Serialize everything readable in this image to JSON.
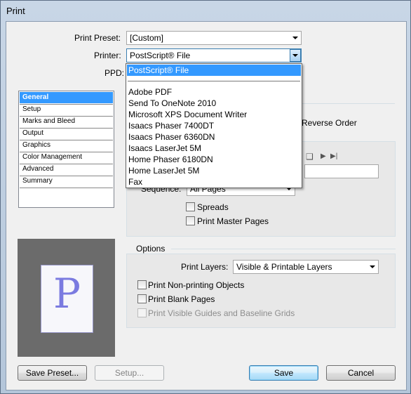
{
  "window": {
    "title": "Print"
  },
  "print_preset": {
    "label": "Print Preset:",
    "value": "[Custom]"
  },
  "printer": {
    "label": "Printer:",
    "value": "PostScript® File"
  },
  "ppd": {
    "label": "PPD:"
  },
  "sidebar": {
    "items": [
      {
        "label": "General",
        "selected": true
      },
      {
        "label": "Setup"
      },
      {
        "label": "Marks and Bleed"
      },
      {
        "label": "Output"
      },
      {
        "label": "Graphics"
      },
      {
        "label": "Color Management"
      },
      {
        "label": "Advanced"
      },
      {
        "label": "Summary"
      }
    ]
  },
  "printer_dropdown": {
    "items": [
      "PostScript® File",
      "Adobe PDF",
      "Send To OneNote 2010",
      "Microsoft XPS Document Writer",
      "Isaacs Phaser 7400DT",
      "Isaacs Phaser 6360DN",
      "Isaacs LaserJet 5M",
      "Home Phaser 6180DN",
      "Home LaserJet 5M",
      "Fax"
    ],
    "highlighted": "PostScript® File"
  },
  "pages": {
    "reverse_order_label": "Reverse Order",
    "sequence_label": "Sequence:",
    "sequence_value": "All Pages",
    "spreads_label": "Spreads",
    "print_master_pages_label": "Print Master Pages"
  },
  "options": {
    "title": "Options",
    "print_layers_label": "Print Layers:",
    "print_layers_value": "Visible & Printable Layers",
    "nonprinting_label": "Print Non-printing Objects",
    "blank_pages_label": "Print Blank Pages",
    "guides_label": "Print Visible Guides and Baseline Grids"
  },
  "preview": {
    "page_letter": "P"
  },
  "buttons": {
    "save_preset": "Save Preset...",
    "setup": "Setup...",
    "save": "Save",
    "cancel": "Cancel"
  },
  "colors": {
    "highlight": "#3399ff",
    "preview_bg": "#6b6b6b",
    "page_letter": "#7b7be0"
  }
}
